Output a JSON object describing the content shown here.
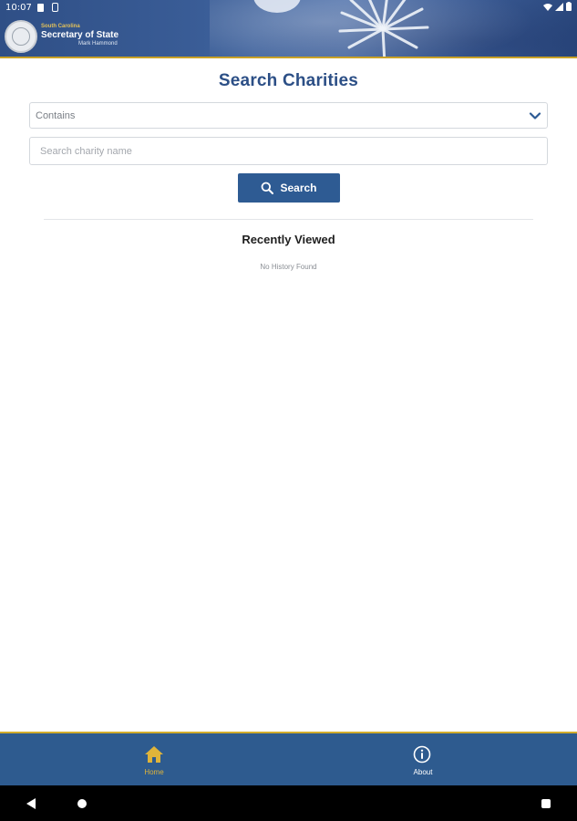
{
  "status_bar": {
    "time": "10:07"
  },
  "header": {
    "state_label": "South Carolina",
    "agency_title": "Secretary of State",
    "official_name": "Mark Hammond"
  },
  "main": {
    "title": "Search Charities",
    "match_select": {
      "selected": "Contains"
    },
    "search_input": {
      "placeholder": "Search charity name",
      "value": ""
    },
    "search_button_label": "Search",
    "recent": {
      "title": "Recently Viewed",
      "empty_text": "No History Found"
    }
  },
  "bottom_nav": {
    "items": [
      {
        "label": "Home",
        "icon": "home-icon",
        "active": true
      },
      {
        "label": "About",
        "icon": "info-icon",
        "active": false
      }
    ]
  },
  "colors": {
    "brand_blue": "#2c4f86",
    "button_blue": "#2e5b93",
    "nav_bg": "#2e5b8f",
    "gold_accent": "#d1ac2c",
    "active_nav": "#e0b43a"
  }
}
